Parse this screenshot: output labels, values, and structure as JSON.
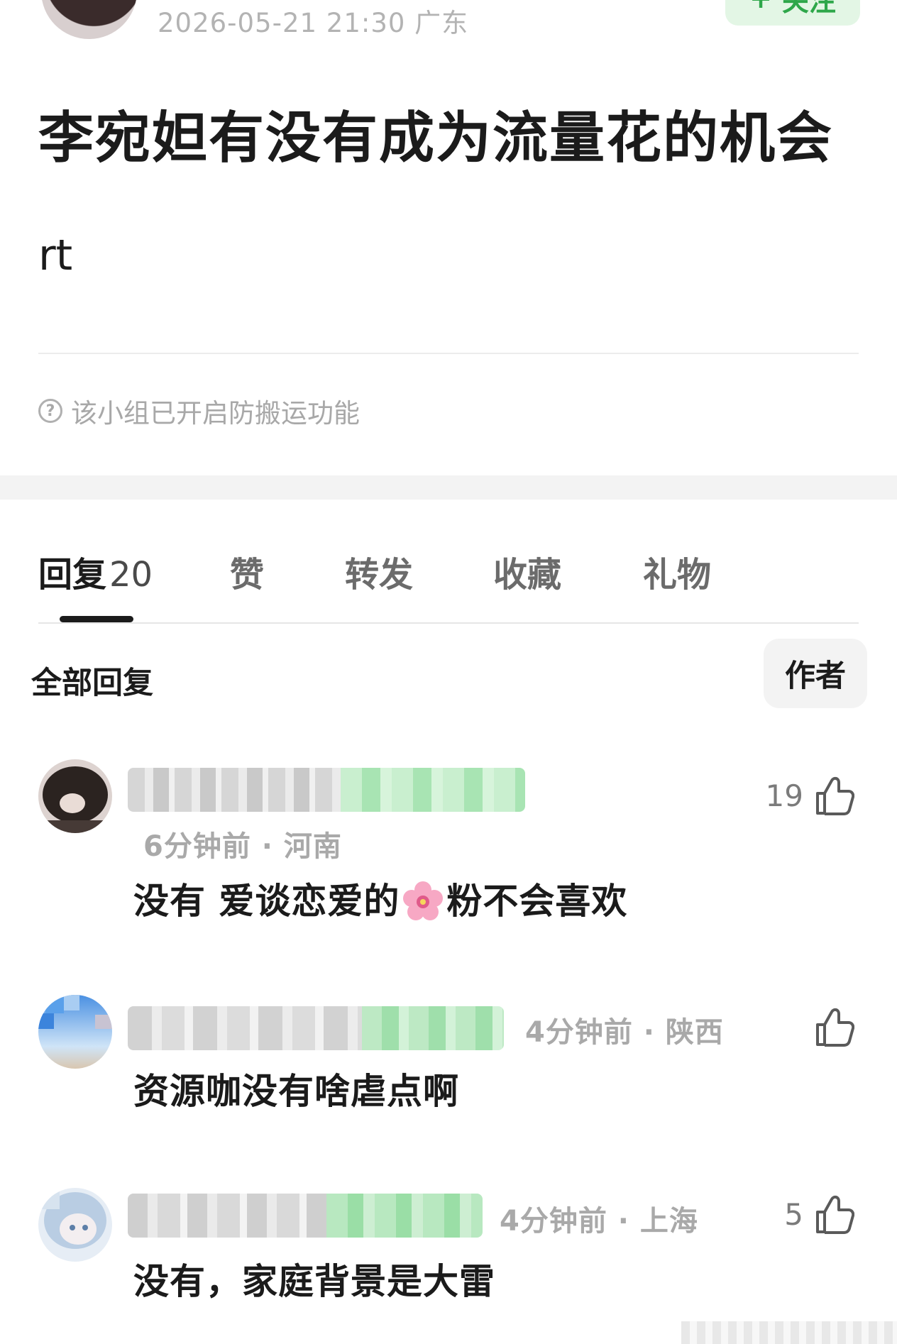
{
  "post": {
    "meta": "2026-05-21 21:30  广东",
    "follow_label": "关注",
    "title": "李宛妲有没有成为流量花的机会",
    "body": "rt",
    "anti_copy_notice": "该小组已开启防搬运功能"
  },
  "tabs": [
    {
      "label": "回复",
      "count": "20",
      "active": true
    },
    {
      "label": "赞"
    },
    {
      "label": "转发"
    },
    {
      "label": "收藏"
    },
    {
      "label": "礼物"
    }
  ],
  "replies_header": {
    "all_label": "全部回复",
    "author_filter": "作者"
  },
  "comments": [
    {
      "meta": "6分钟前 · 河南",
      "text_before": "没有 爱谈恋爱的",
      "emoji": "cherry-blossom",
      "text_after": "粉不会喜欢",
      "likes": "19"
    },
    {
      "meta": "4分钟前 · 陕西",
      "text": "资源咖没有啥虐点啊",
      "likes": ""
    },
    {
      "meta": "4分钟前 · 上海",
      "text": "没有，家庭背景是大雷",
      "likes": "5"
    }
  ],
  "colors": {
    "accent_green": "#2ea74a",
    "follow_bg": "#e3f6e5",
    "muted_text": "#a9a9a9",
    "section_gap": "#f3f3f3"
  }
}
